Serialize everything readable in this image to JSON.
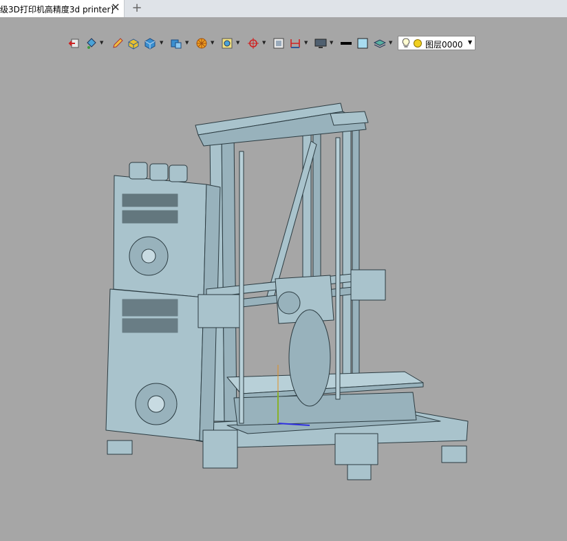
{
  "tabs": [
    {
      "title": "级3D打印机高精度3d printer]",
      "active": true
    }
  ],
  "tab_close_glyph": "✕",
  "tab_add_glyph": "+",
  "toolbar": {
    "icons": [
      "exit-icon",
      "paint-bucket-icon",
      "pencil-icon",
      "box-yellow-icon",
      "cube-icon",
      "cube-multi-icon",
      "wheel-icon",
      "view-fit-icon",
      "rotate-axis-icon",
      "frame-icon",
      "dimension-icon",
      "monitor-icon",
      "line-weight-icon",
      "color-swatch-icon",
      "layers-icon"
    ],
    "layer_select": {
      "value": "图层0000"
    }
  },
  "colors": {
    "background": "#a6a6a6",
    "model": "#a9c3cc",
    "outline": "#2a3a40",
    "tab_bg": "#dfe3e8"
  }
}
